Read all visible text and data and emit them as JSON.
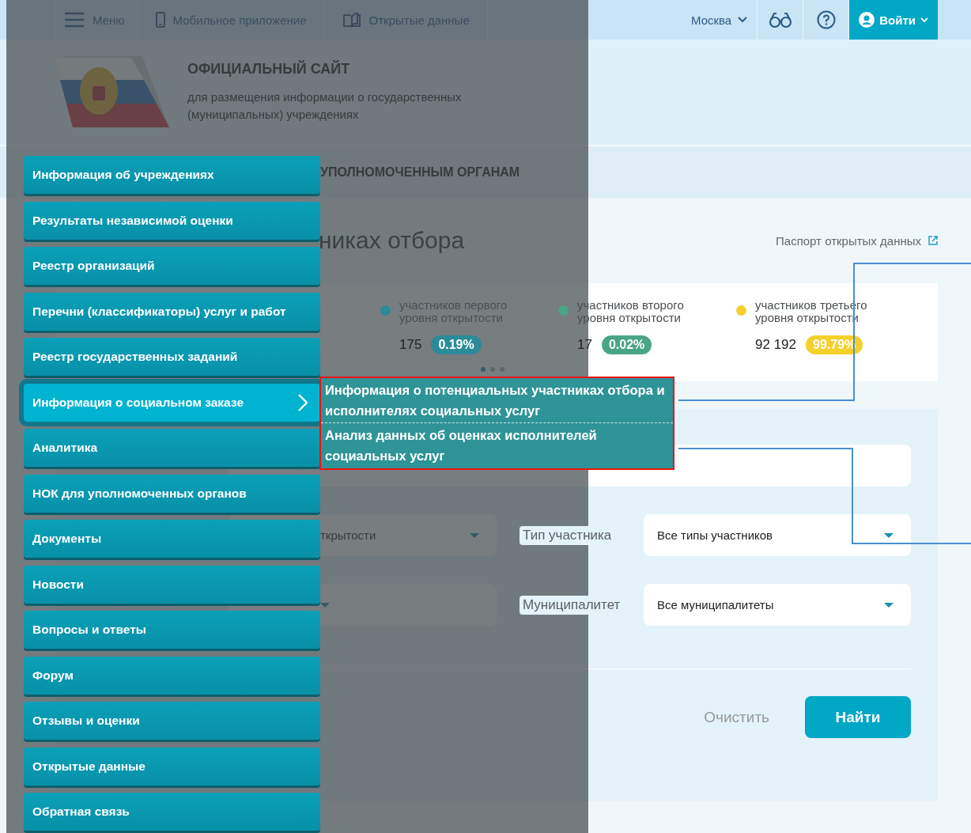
{
  "topbar": {
    "menu_label": "Меню",
    "links": [
      {
        "kind": "phone",
        "label": "Мобильное приложение"
      },
      {
        "kind": "book",
        "label": "Открытые данные"
      }
    ],
    "city": "Москва",
    "login": "Войти"
  },
  "header": {
    "title": "ОФИЦИАЛЬНЫЙ САЙТ",
    "subtitle": "для размещения информации о государственных (муниципальных) учреждениях"
  },
  "section_tab": "УПОЛНОМОЧЕННЫМ ОРГАНАМ",
  "page_title": "никах отбора",
  "passport_link": "Паспорт открытых данных",
  "stats": [
    {
      "label": "участников первого уровня открытости",
      "count": "175",
      "percent": "0.19%",
      "color": "#2b8b98"
    },
    {
      "label": "участников второго уровня открытости",
      "count": "17",
      "percent": "0.02%",
      "color": "#4aa585"
    },
    {
      "label": "участников третьего уровня открытости",
      "count": "92 192",
      "percent": "99.79%",
      "color": "#f5d02c"
    }
  ],
  "pagination": [
    {
      "selected": true
    },
    {
      "selected": false
    },
    {
      "selected": false
    }
  ],
  "filter_rows": [
    {
      "left_value": "ткрытости",
      "label": "Тип участника",
      "value": "Все типы участников"
    },
    {
      "label": "Муниципалитет",
      "value": "Все муниципалитеты"
    }
  ],
  "buttons": {
    "clear": "Очистить",
    "search": "Найти"
  },
  "menu": [
    {
      "label": "Информация об учреждениях",
      "selected": false,
      "has_submenu": false
    },
    {
      "label": "Результаты независимой оценки",
      "selected": false,
      "has_submenu": false
    },
    {
      "label": "Реестр организаций",
      "selected": false,
      "has_submenu": false
    },
    {
      "label": "Перечни (классификаторы) услуг и работ",
      "selected": false,
      "has_submenu": false
    },
    {
      "label": "Реестр государственных заданий",
      "selected": false,
      "has_submenu": false
    },
    {
      "label": "Информация о социальном заказе",
      "selected": true,
      "has_submenu": true
    },
    {
      "label": "Аналитика",
      "selected": false,
      "has_submenu": false
    },
    {
      "label": "НОК для уполномоченных органов",
      "selected": false,
      "has_submenu": false
    },
    {
      "label": "Документы",
      "selected": false,
      "has_submenu": false
    },
    {
      "label": "Новости",
      "selected": false,
      "has_submenu": false
    },
    {
      "label": "Вопросы и ответы",
      "selected": false,
      "has_submenu": false
    },
    {
      "label": "Форум",
      "selected": false,
      "has_submenu": false
    },
    {
      "label": "Отзывы и оценки",
      "selected": false,
      "has_submenu": false
    },
    {
      "label": "Открытые данные",
      "selected": false,
      "has_submenu": false
    },
    {
      "label": "Обратная связь",
      "selected": false,
      "has_submenu": false
    }
  ],
  "submenu": [
    "Информация о потенциальных участниках отбора и исполнителях социальных услуг",
    "Анализ данных об оценках исполнителей социальных услуг"
  ]
}
